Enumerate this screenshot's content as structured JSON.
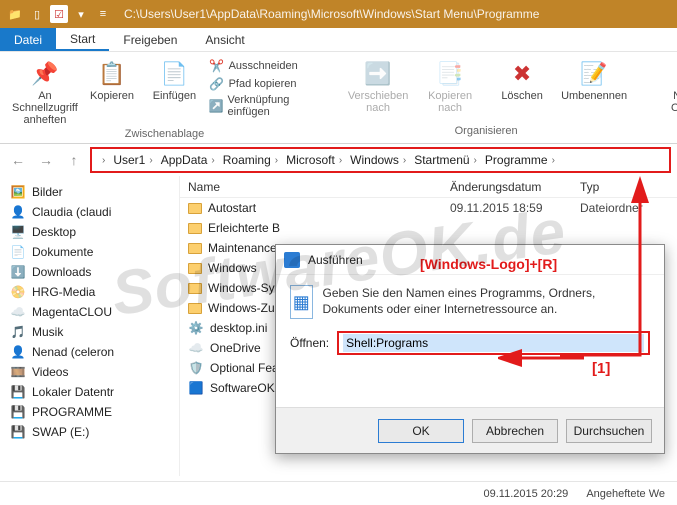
{
  "title_path": "C:\\Users\\User1\\AppData\\Roaming\\Microsoft\\Windows\\Start Menu\\Programme",
  "menu": {
    "file": "Datei",
    "start": "Start",
    "share": "Freigeben",
    "view": "Ansicht"
  },
  "ribbon": {
    "pin": "An Schnellzugriff anheften",
    "copy": "Kopieren",
    "paste": "Einfügen",
    "cut": "Ausschneiden",
    "copypath": "Pfad kopieren",
    "pastelink": "Verknüpfung einfügen",
    "move": "Verschieben nach",
    "copyto": "Kopieren nach",
    "delete": "Löschen",
    "rename": "Umbenennen",
    "newfolder": "Neuer Ordner",
    "group_clipboard": "Zwischenablage",
    "group_organize": "Organisieren"
  },
  "breadcrumbs": [
    "User1",
    "AppData",
    "Roaming",
    "Microsoft",
    "Windows",
    "Startmenü",
    "Programme"
  ],
  "columns": {
    "name": "Name",
    "modified": "Änderungsdatum",
    "type": "Typ"
  },
  "sidebar": [
    {
      "icon": "🖼️",
      "label": "Bilder"
    },
    {
      "icon": "👤",
      "label": "Claudia (claudi"
    },
    {
      "icon": "🖥️",
      "label": "Desktop"
    },
    {
      "icon": "📄",
      "label": "Dokumente"
    },
    {
      "icon": "⬇️",
      "label": "Downloads"
    },
    {
      "icon": "📀",
      "label": "HRG-Media"
    },
    {
      "icon": "☁️",
      "label": "MagentaCLOU"
    },
    {
      "icon": "🎵",
      "label": "Musik"
    },
    {
      "icon": "👤",
      "label": "Nenad (celeron"
    },
    {
      "icon": "🎞️",
      "label": "Videos"
    },
    {
      "icon": "💾",
      "label": "Lokaler Datentr"
    },
    {
      "icon": "💾",
      "label": "PROGRAMME"
    },
    {
      "icon": "💾",
      "label": "SWAP (E:)"
    }
  ],
  "files": [
    {
      "t": "folder",
      "name": "Autostart",
      "date": "09.11.2015 18:59",
      "type": "Dateiordner"
    },
    {
      "t": "folder",
      "name": "Erleichterte B",
      "date": "",
      "type": ""
    },
    {
      "t": "folder",
      "name": "Maintenance",
      "date": "",
      "type": ""
    },
    {
      "t": "folder",
      "name": "Windows",
      "date": "",
      "type": ""
    },
    {
      "t": "folder",
      "name": "Windows-Sy",
      "date": "",
      "type": ""
    },
    {
      "t": "folder",
      "name": "Windows-Zu",
      "date": "",
      "type": ""
    },
    {
      "t": "file",
      "icon": "⚙️",
      "name": "desktop.ini",
      "date": "",
      "type": ""
    },
    {
      "t": "file",
      "icon": "☁️",
      "name": "OneDrive",
      "date": "",
      "type": ""
    },
    {
      "t": "file",
      "icon": "🛡️",
      "name": "Optional Fea",
      "date": "",
      "type": ""
    },
    {
      "t": "file",
      "icon": "🟦",
      "name": "SoftwareOK",
      "date": "",
      "type": ""
    }
  ],
  "run": {
    "title": "Ausführen",
    "hint": "Geben Sie den Namen eines Programms, Ordners, Dokuments oder einer Internetressource an.",
    "label": "Öffnen:",
    "value": "Shell:Programs",
    "ok": "OK",
    "cancel": "Abbrechen",
    "browse": "Durchsuchen"
  },
  "annot": {
    "keys": "[Windows-Logo]+[R]",
    "num": "[1]"
  },
  "status": {
    "date": "09.11.2015 20:29",
    "type": "Angeheftete We"
  },
  "watermark": "SoftwareOK.de"
}
